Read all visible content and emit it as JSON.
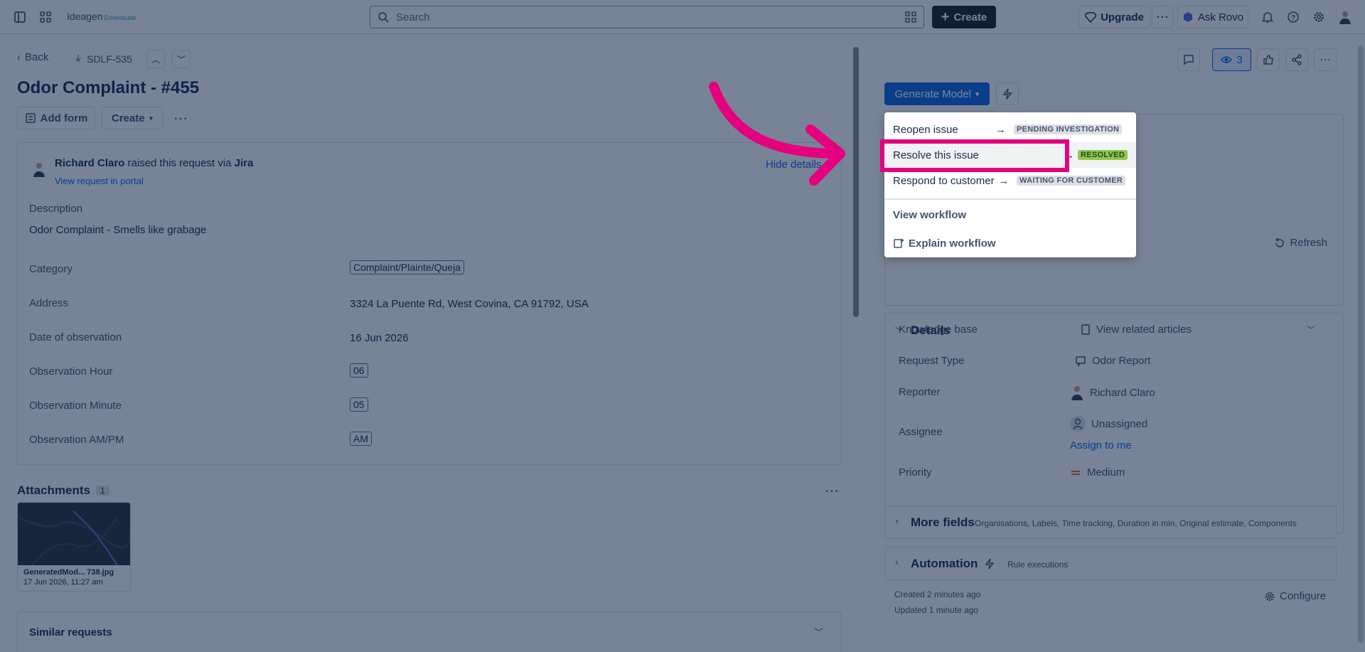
{
  "topbar": {
    "logo": "Ideagen",
    "logo_sub": "Envirosuite",
    "search_placeholder": "Search",
    "create_label": "Create",
    "upgrade_label": "Upgrade",
    "ask_rovo_label": "Ask Rovo"
  },
  "issue": {
    "back_label": "Back",
    "key": "SDLF-535",
    "title": "Odor Complaint - #455",
    "add_form_label": "Add form",
    "create_label": "Create"
  },
  "request": {
    "reporter": "Richard Claro",
    "raised_text": "raised this request via",
    "source": "Jira",
    "portal_link": "View request in portal",
    "hide_details": "Hide details",
    "description_label": "Description",
    "description": "Odor Complaint - Smells like grabage",
    "fields": [
      {
        "label": "Category",
        "value": "Complaint/Plainte/Queja"
      },
      {
        "label": "Address",
        "value": "3324 La Puente Rd, West Covina, CA 91792, USA"
      },
      {
        "label": "Date of observation",
        "value": "16 Jun 2026"
      },
      {
        "label": "Observation Hour",
        "value": "06"
      },
      {
        "label": "Observation Minute",
        "value": "05"
      },
      {
        "label": "Observation AM/PM",
        "value": "AM"
      }
    ]
  },
  "attachments": {
    "label": "Attachments",
    "count": "1",
    "file_name": "GeneratedMod... 738.jpg",
    "file_date": "17 Jun 2026, 11:27 am"
  },
  "similar_label": "Similar requests",
  "watch_count": "3",
  "status_button": "Generate Model",
  "transition_menu": {
    "items": [
      {
        "label": "Reopen issue",
        "status": "PENDING INVESTIGATION"
      },
      {
        "label": "Resolve this issue",
        "status": "RESOLVED"
      },
      {
        "label": "Respond to customer",
        "status": "WAITING FOR CUSTOMER"
      }
    ],
    "view_workflow": "View workflow",
    "explain_workflow": "Explain workflow"
  },
  "refresh_label": "Refresh",
  "details": {
    "heading": "Details",
    "rows": [
      {
        "label": "Knowledge base",
        "value": "View related articles"
      },
      {
        "label": "Request Type",
        "value": "Odor Report"
      },
      {
        "label": "Reporter",
        "value": "Richard Claro"
      },
      {
        "label": "Assignee",
        "value": "Unassigned",
        "link": "Assign to me"
      },
      {
        "label": "Priority",
        "value": "Medium"
      }
    ]
  },
  "more_fields": {
    "heading": "More fields",
    "sub": "Organisations, Labels, Time tracking, Duration in min, Original estimate, Components"
  },
  "automation": {
    "heading": "Automation",
    "sub": "Rule executions"
  },
  "created": "Created 2 minutes ago",
  "updated": "Updated 1 minute ago",
  "configure_label": "Configure",
  "colors": {
    "highlight": "#e5007e",
    "primary": "#0c66e4",
    "resolved": "#94c748"
  }
}
